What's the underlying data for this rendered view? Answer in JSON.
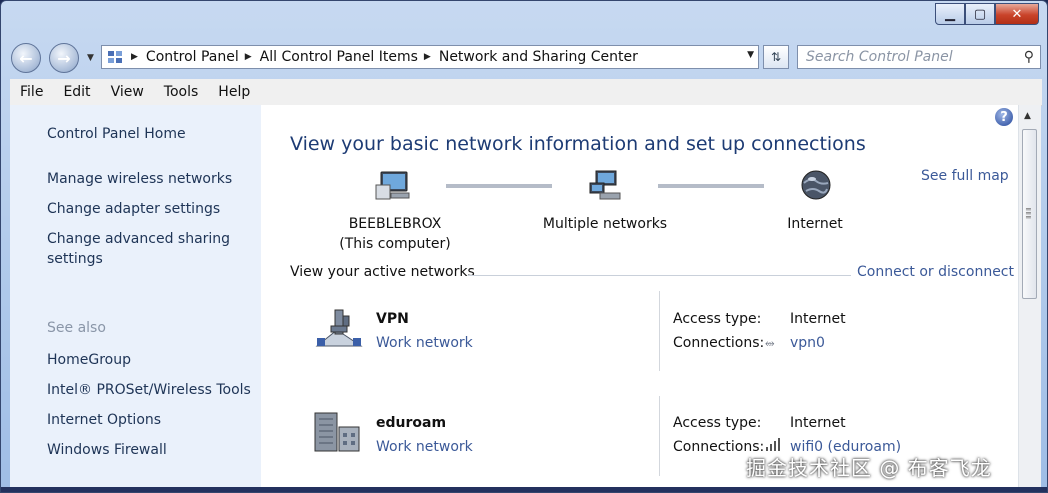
{
  "window": {
    "min_glyph": "▁",
    "max_glyph": "▢",
    "close_glyph": "✕"
  },
  "address": {
    "crumbs": [
      "Control Panel",
      "All Control Panel Items",
      "Network and Sharing Center"
    ],
    "search_placeholder": "Search Control Panel"
  },
  "menu": [
    "File",
    "Edit",
    "View",
    "Tools",
    "Help"
  ],
  "left_pane": {
    "home": "Control Panel Home",
    "links": [
      "Manage wireless networks",
      "Change adapter settings",
      "Change advanced sharing",
      "settings"
    ],
    "see_also_heading": "See also",
    "see_also": [
      "HomeGroup",
      "Intel® PROSet/Wireless Tools",
      "Internet Options",
      "Windows Firewall"
    ]
  },
  "main": {
    "title": "View your basic network information and set up connections",
    "see_full_map": "See full map",
    "map": {
      "computer_name": "BEEBLEBROX",
      "computer_sub": "(This computer)",
      "middle": "Multiple networks",
      "internet": "Internet"
    },
    "active_networks_label": "View your active networks",
    "connect_disconnect": "Connect or disconnect",
    "networks": [
      {
        "name": "VPN",
        "type": "Work network",
        "access_label": "Access type:",
        "access_value": "Internet",
        "connections_label": "Connections:",
        "connection": "vpn0"
      },
      {
        "name": "eduroam",
        "type": "Work network",
        "access_label": "Access type:",
        "access_value": "Internet",
        "connections_label": "Connections:",
        "connection": "wifi0 (eduroam)"
      }
    ]
  },
  "watermark": "掘金技术社区 @ 布客飞龙",
  "colors": {
    "link": "#3b5998",
    "title": "#1d3b74",
    "left_pane_bg": "#eaf1fb"
  }
}
